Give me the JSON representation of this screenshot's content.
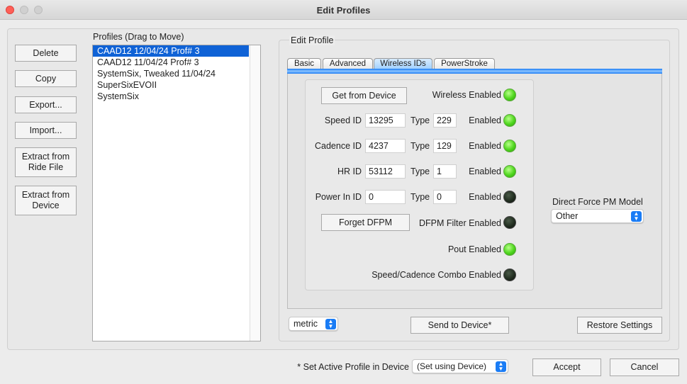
{
  "window": {
    "title": "Edit Profiles"
  },
  "left_buttons": {
    "delete": "Delete",
    "copy": "Copy",
    "export": "Export...",
    "import": "Import...",
    "extract_ride_1": "Extract from",
    "extract_ride_2": "Ride File",
    "extract_device_1": "Extract from",
    "extract_device_2": "Device"
  },
  "profiles": {
    "label": "Profiles (Drag to Move)",
    "items": [
      "CAAD12 12/04/24 Prof# 3",
      "CAAD12 11/04/24 Prof# 3",
      "SystemSix, Tweaked 11/04/24",
      "SuperSixEVOII",
      "SystemSix"
    ],
    "selected_index": 0
  },
  "edit_profile": {
    "label": "Edit Profile",
    "tabs": [
      "Basic",
      "Advanced",
      "Wireless IDs",
      "PowerStroke"
    ],
    "active_tab": "Wireless IDs",
    "get_from_device": "Get from Device",
    "forget_dfpm": "Forget DFPM",
    "wireless_enabled": "Wireless Enabled",
    "type_label": "Type",
    "enabled_label": "Enabled",
    "rows": [
      {
        "label": "Speed ID",
        "id": "13295",
        "type": "229",
        "enabled": true
      },
      {
        "label": "Cadence ID",
        "id": "4237",
        "type": "129",
        "enabled": true
      },
      {
        "label": "HR ID",
        "id": "53112",
        "type": "1",
        "enabled": true
      },
      {
        "label": "Power In ID",
        "id": "0",
        "type": "0",
        "enabled": false
      }
    ],
    "dfpm_filter": "DFPM Filter Enabled",
    "pout": "Pout Enabled",
    "combo": "Speed/Cadence Combo Enabled",
    "dfpm_model_label": "Direct Force PM Model",
    "dfpm_model_value": "Other",
    "units": "metric",
    "send": "Send to Device*",
    "restore": "Restore Settings"
  },
  "footer": {
    "active_label": "* Set Active Profile in Device",
    "active_value": "(Set using Device)",
    "accept": "Accept",
    "cancel": "Cancel"
  },
  "colors": {
    "led_on": "#4ed61d",
    "led_off": "#1f2b1e",
    "selection": "#0f62d6"
  }
}
